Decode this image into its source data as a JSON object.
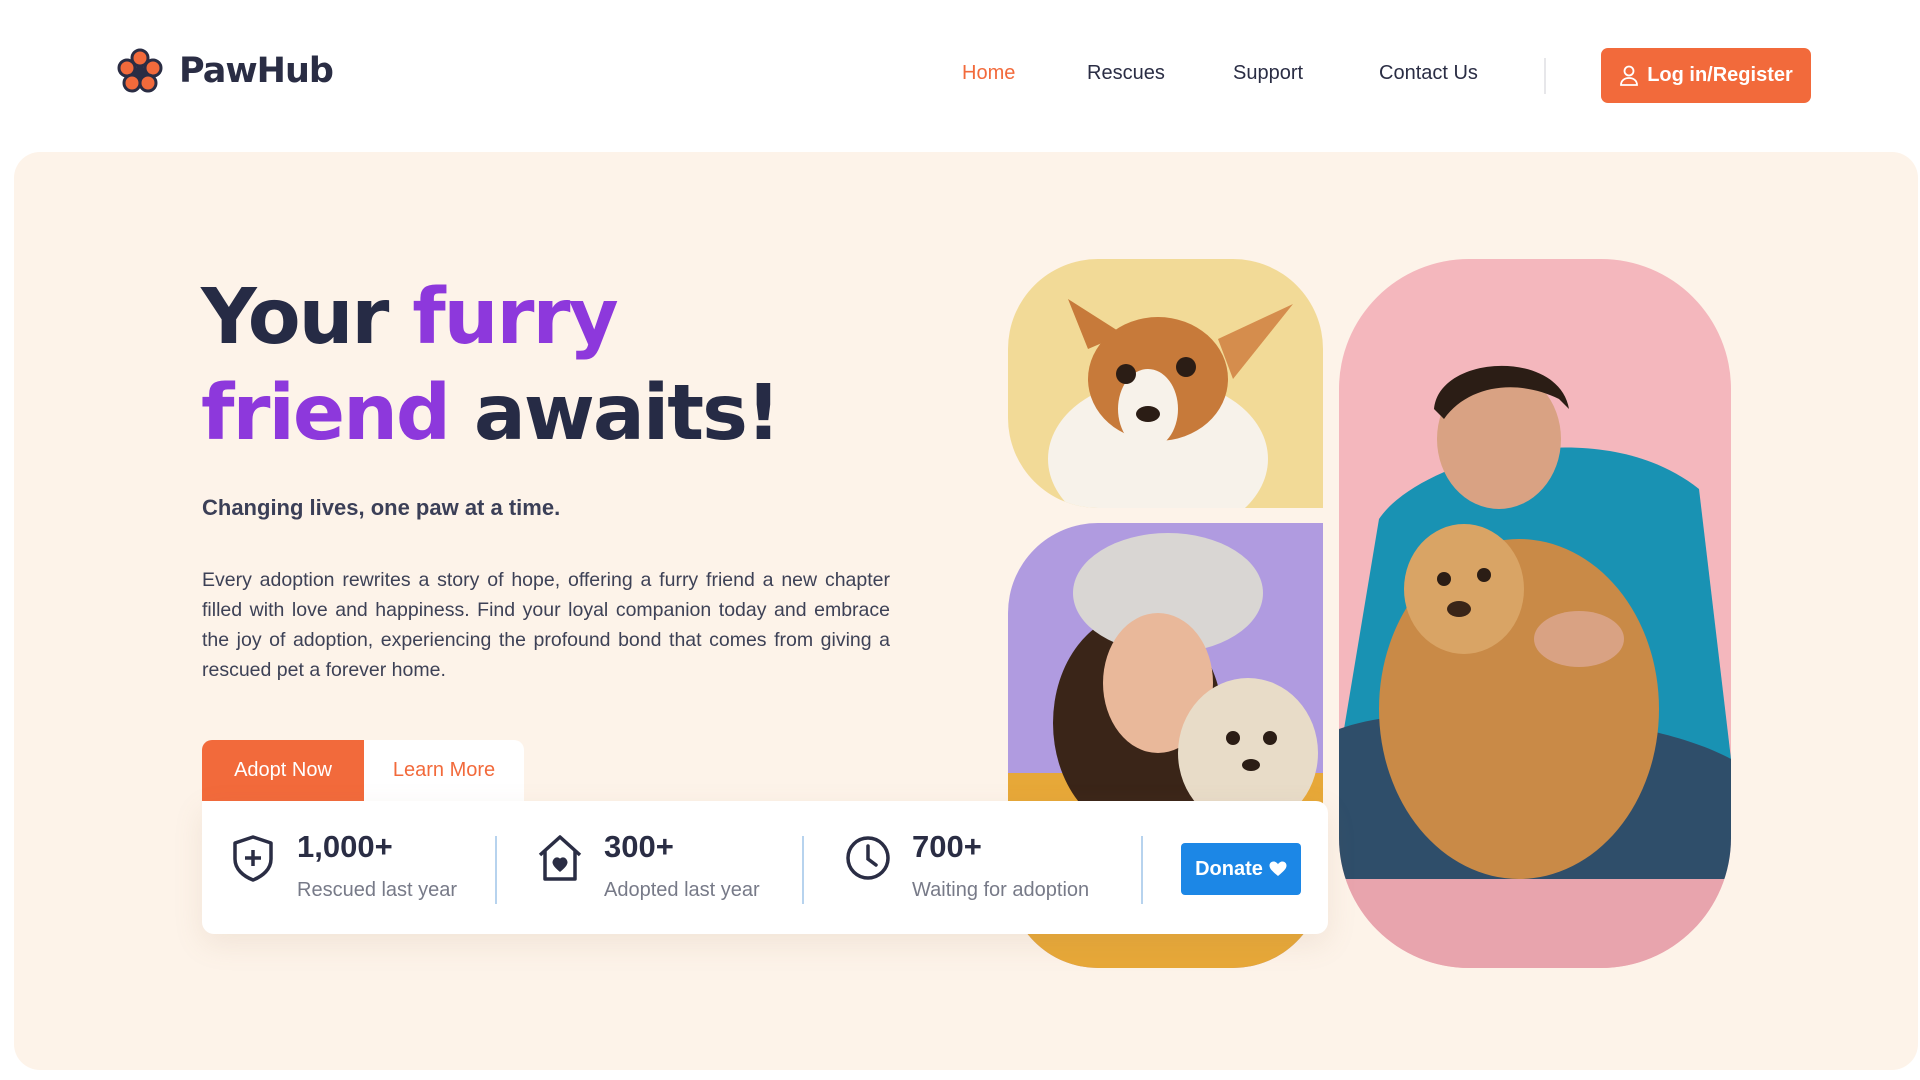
{
  "brand": {
    "name": "PawHub",
    "accent": "#f26a3b",
    "purple": "#8d38dc",
    "donate_blue": "#1c87e6"
  },
  "nav": {
    "items": [
      {
        "label": "Home",
        "active": true
      },
      {
        "label": "Rescues",
        "active": false
      },
      {
        "label": "Support",
        "active": false
      },
      {
        "label": "Contact Us",
        "active": false
      }
    ],
    "login_label": "Log in/Register",
    "login_icon": "user-icon"
  },
  "hero": {
    "title_part1": "Your ",
    "title_accent1": "furry",
    "title_accent2": "friend",
    "title_part2": " awaits!",
    "subtitle": "Changing lives, one paw at a time.",
    "description": "Every adoption rewrites a story of hope, offering a furry friend a new chapter filled with love and happiness. Find your loyal companion today and embrace the joy of adoption, experiencing the profound bond that comes from giving a rescued pet a forever home.",
    "adopt_label": "Adopt Now",
    "learn_label": "Learn More"
  },
  "stats": [
    {
      "icon": "shield-plus-icon",
      "value": "1,000+",
      "label": "Rescued last year"
    },
    {
      "icon": "house-heart-icon",
      "value": "300+",
      "label": "Adopted last year"
    },
    {
      "icon": "clock-icon",
      "value": "700+",
      "label": "Waiting for adoption"
    }
  ],
  "donate": {
    "label": "Donate",
    "icon": "heart-icon"
  },
  "images": {
    "dog": "chihuahua-photo",
    "woman": "woman-with-shih-tzu-photo",
    "man": "man-hugging-dog-photo"
  }
}
